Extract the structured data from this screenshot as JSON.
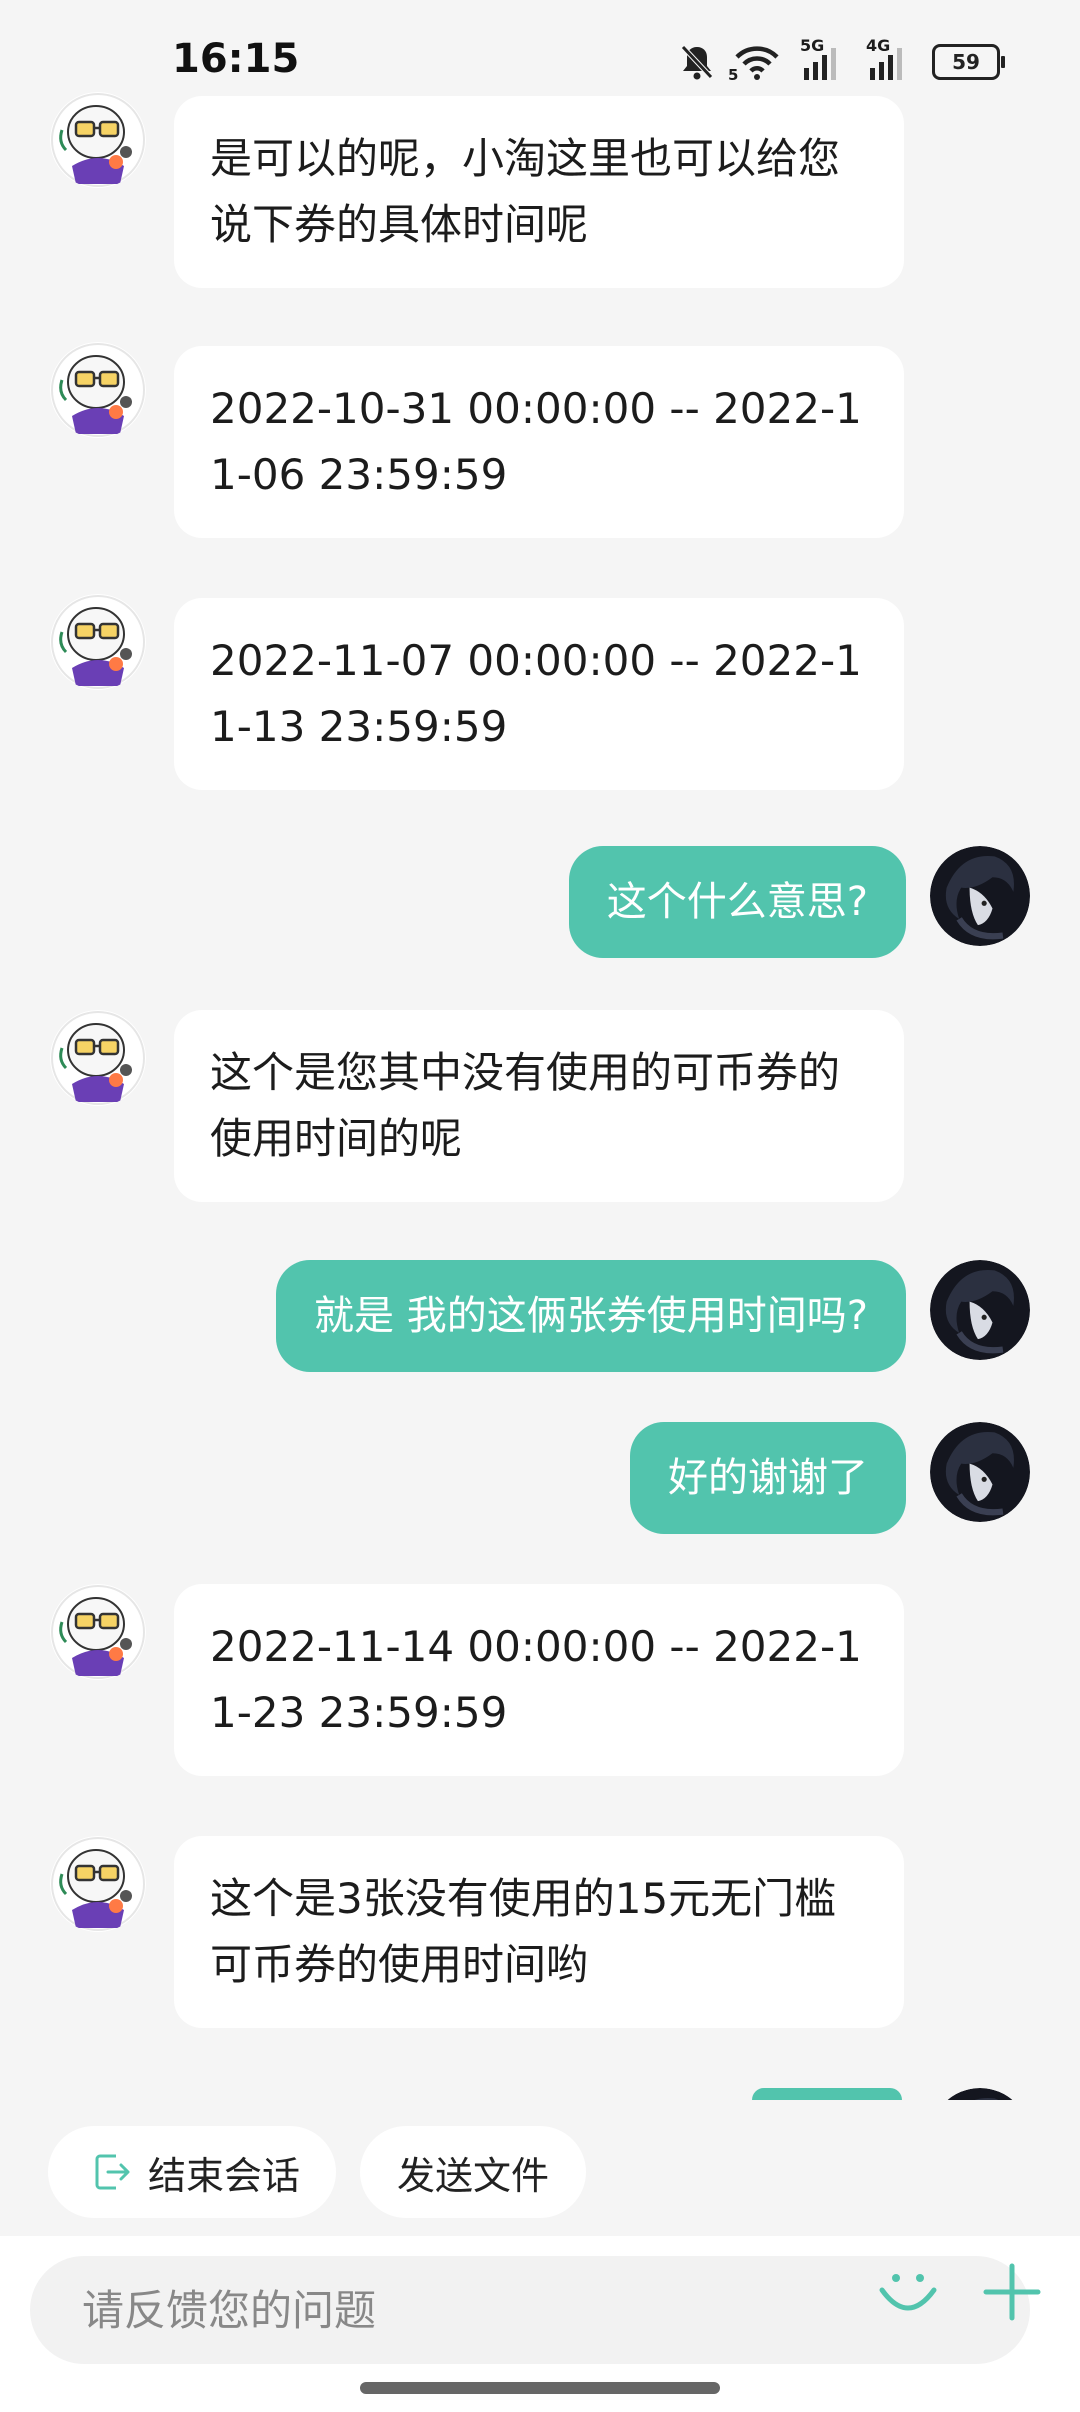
{
  "status_bar": {
    "time": "16:15",
    "battery": "59",
    "signal_1": "5G",
    "signal_2": "4G",
    "wifi_badge": "5",
    "icons": [
      "bell-off-icon",
      "wifi-icon",
      "signal-5g-icon",
      "signal-4g-icon",
      "battery-icon"
    ]
  },
  "messages": [
    {
      "from": "agent",
      "text": "是可以的呢，小淘这里也可以给您说下券的具体时间呢"
    },
    {
      "from": "agent",
      "text": "2022-10-31 00:00:00 -- 2022-11-06 23:59:59"
    },
    {
      "from": "agent",
      "text": "2022-11-07 00:00:00 -- 2022-11-13 23:59:59"
    },
    {
      "from": "user",
      "text": "这个什么意思?"
    },
    {
      "from": "agent",
      "text": "这个是您其中没有使用的可币券的使用时间的呢"
    },
    {
      "from": "user",
      "text": "就是 我的这俩张券使用时间吗?"
    },
    {
      "from": "user",
      "text": "好的谢谢了"
    },
    {
      "from": "agent",
      "text": "2022-11-14 00:00:00 -- 2022-11-23 23:59:59"
    },
    {
      "from": "agent",
      "text": "这个是3张没有使用的15元无门槛可币券的使用时间哟"
    }
  ],
  "quick_actions": {
    "end_session": "结束会话",
    "send_file": "发送文件"
  },
  "input": {
    "placeholder": "请反馈您的问题"
  },
  "colors": {
    "accent": "#52c4ad",
    "background": "#f5f5f5",
    "bubble_in": "#ffffff"
  }
}
